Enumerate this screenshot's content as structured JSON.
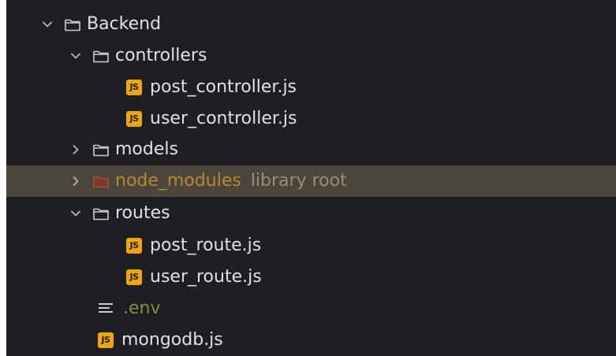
{
  "project_tree": {
    "items": [
      {
        "label": "Backend",
        "type": "folder",
        "state": "expanded",
        "icon": "folder-icon"
      },
      {
        "label": "controllers",
        "type": "folder",
        "state": "expanded",
        "icon": "folder-icon"
      },
      {
        "label": "post_controller.js",
        "type": "file",
        "icon": "js-file-icon",
        "icon_text": "JS"
      },
      {
        "label": "user_controller.js",
        "type": "file",
        "icon": "js-file-icon",
        "icon_text": "JS"
      },
      {
        "label": "models",
        "type": "folder",
        "state": "collapsed",
        "icon": "folder-icon"
      },
      {
        "label": "node_modules",
        "hint": "library root",
        "type": "folder",
        "state": "collapsed",
        "selected": true,
        "icon": "folder-icon",
        "color": "#b38a2e"
      },
      {
        "label": "routes",
        "type": "folder",
        "state": "expanded",
        "icon": "folder-icon"
      },
      {
        "label": "post_route.js",
        "type": "file",
        "icon": "js-file-icon",
        "icon_text": "JS"
      },
      {
        "label": "user_route.js",
        "type": "file",
        "icon": "js-file-icon",
        "icon_text": "JS"
      },
      {
        "label": ".env",
        "type": "file",
        "icon": "text-file-icon",
        "color": "#8a8a3a"
      },
      {
        "label": "mongodb.js",
        "type": "file",
        "icon": "js-file-icon",
        "icon_text": "JS"
      }
    ]
  },
  "colors": {
    "background": "#1e1f22",
    "selection": "#4a463c",
    "text": "#dfe1e5",
    "js_badge": "#f0a50a",
    "excluded_folder": "#b38a2e"
  }
}
